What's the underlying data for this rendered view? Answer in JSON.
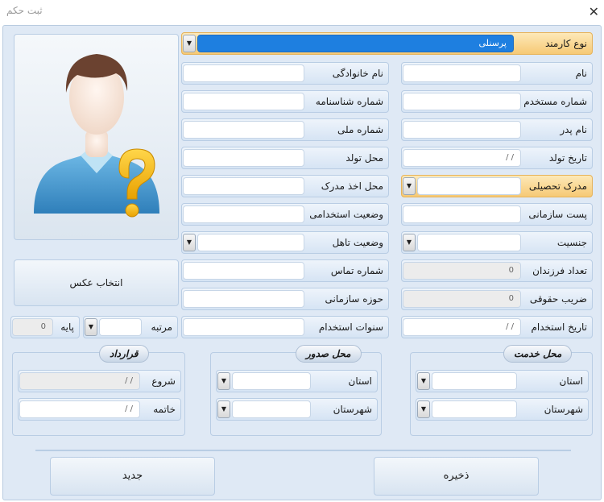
{
  "window": {
    "title": "ثبت حکم",
    "close_glyph": "✕"
  },
  "employee_type": {
    "label": "نوع کارمند",
    "value": "پرسنلی"
  },
  "right_col": {
    "first_name": {
      "label": "نام",
      "value": ""
    },
    "employee_number": {
      "label": "شماره مستخدم",
      "value": ""
    },
    "father_name": {
      "label": "نام پدر",
      "value": ""
    },
    "birth_date": {
      "label": "تاریخ تولد",
      "value": "/ /"
    },
    "education": {
      "label": "مدرک تحصیلی",
      "value": ""
    },
    "org_post": {
      "label": "پست سازمانی",
      "value": ""
    },
    "gender": {
      "label": "جنسیت",
      "value": ""
    },
    "children": {
      "label": "تعداد فرزندان",
      "value": "0"
    },
    "salary_coef": {
      "label": "ضریب حقوقی",
      "value": "0"
    },
    "hire_date": {
      "label": "تاریخ استخدام",
      "value": "/ /"
    }
  },
  "mid_col": {
    "last_name": {
      "label": "نام خانوادگی",
      "value": ""
    },
    "id_number": {
      "label": "شماره شناسنامه",
      "value": ""
    },
    "national_id": {
      "label": "شماره ملی",
      "value": ""
    },
    "birth_place": {
      "label": "محل تولد",
      "value": ""
    },
    "degree_place": {
      "label": "محل اخذ مدرک",
      "value": ""
    },
    "employment_status": {
      "label": "وضعیت استخدامی",
      "value": ""
    },
    "marital_status": {
      "label": "وضعیت تاهل",
      "value": ""
    },
    "phone": {
      "label": "شماره تماس",
      "value": ""
    },
    "org_area": {
      "label": "حوزه سازمانی",
      "value": ""
    },
    "service_years": {
      "label": "سنوات استخدام",
      "value": ""
    }
  },
  "left_col": {
    "photo_button": "انتخاب عکس",
    "rank": {
      "label": "مرتبه",
      "value": ""
    },
    "grade": {
      "label": "پایه",
      "value": "0"
    }
  },
  "groups": {
    "service_place": {
      "title": "محل خدمت",
      "province": {
        "label": "استان",
        "value": ""
      },
      "city": {
        "label": "شهرستان",
        "value": ""
      }
    },
    "issue_place": {
      "title": "محل صدور",
      "province": {
        "label": "استان",
        "value": ""
      },
      "city": {
        "label": "شهرستان",
        "value": ""
      }
    },
    "contract": {
      "title": "قرارداد",
      "start": {
        "label": "شروع",
        "value": "/ /"
      },
      "end": {
        "label": "خاتمه",
        "value": "/ /"
      }
    }
  },
  "buttons": {
    "save": "ذخیره",
    "new": "جدید"
  },
  "colors": {
    "frame_bg": "#dfe9f5",
    "highlight": "#f6c975",
    "selection": "#1e7fe0",
    "avatar_shirt": "#4a9fd4",
    "question_mark": "#f5b800"
  },
  "icons": {
    "dropdown": "▼",
    "avatar": "user-question-avatar-icon"
  }
}
